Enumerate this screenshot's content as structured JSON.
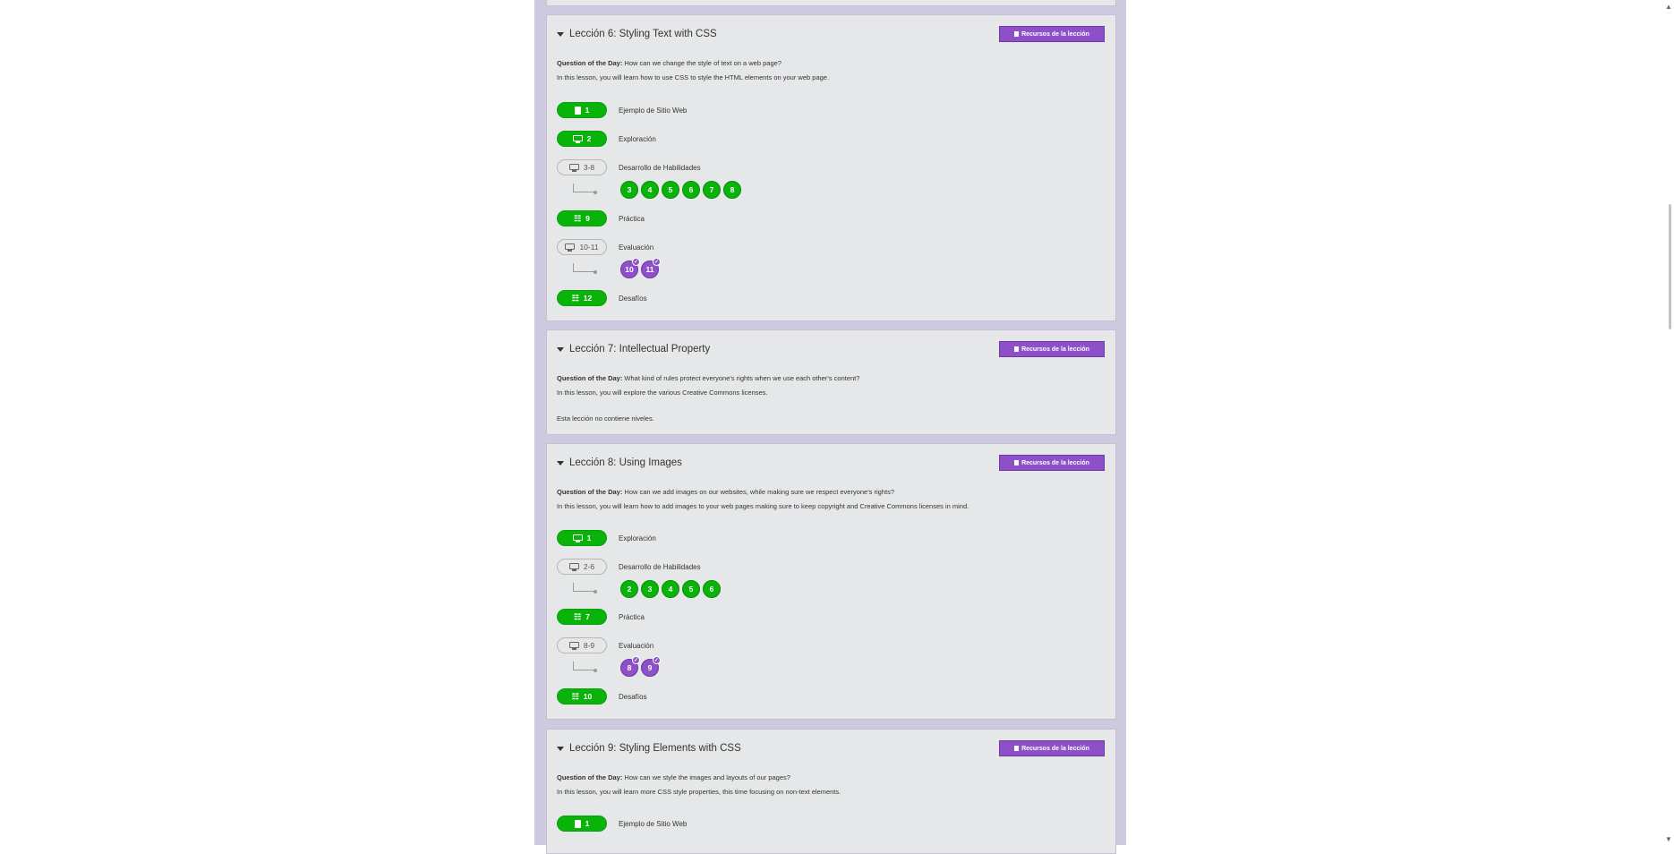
{
  "colors": {
    "green": "#0ab30a",
    "purple": "#8e50c8",
    "card_bg": "#e6e7e8",
    "column_bg": "#cfc9df"
  },
  "resources_label": "Recursos de la lección",
  "lesson6": {
    "title": "Lección 6: Styling Text with CSS",
    "qod_label": "Question of the Day:",
    "qod_text": " How can we change the style of text on a web page?",
    "description": "In this lesson, you will learn how to use CSS to style the HTML elements on your web page.",
    "levels": [
      {
        "badge": "1",
        "label": "Ejemplo de Sitio Web",
        "icon": "document-icon",
        "style": "green"
      },
      {
        "badge": "2",
        "label": "Exploración",
        "icon": "monitor-icon",
        "style": "green"
      },
      {
        "badge": "3-8",
        "label": "Desarrollo de Habilidades",
        "icon": "monitor-icon",
        "style": "outline"
      },
      {
        "badge": "9",
        "label": "Práctica",
        "icon": "hierarchy-icon",
        "style": "green"
      },
      {
        "badge": "10-11",
        "label": "Evaluación",
        "icon": "monitor-icon",
        "style": "outline"
      },
      {
        "badge": "12",
        "label": "Desafíos",
        "icon": "hierarchy-icon",
        "style": "green"
      }
    ],
    "skill_bubbles": [
      "3",
      "4",
      "5",
      "6",
      "7",
      "8"
    ],
    "assessment_bubbles": [
      "10",
      "11"
    ]
  },
  "lesson7": {
    "title": "Lección 7: Intellectual Property",
    "qod_label": "Question of the Day:",
    "qod_text": " What kind of rules protect everyone's rights when we use each other's content?",
    "description": "In this lesson, you will explore the various Creative Commons licenses.",
    "no_levels": "Esta lección no contiene niveles."
  },
  "lesson8": {
    "title": "Lección 8: Using Images",
    "qod_label": "Question of the Day:",
    "qod_text": " How can we add images on our websites, while making sure we respect everyone's rights?",
    "description": "In this lesson, you will learn how to add images to your web pages making sure to keep copyright and Creative Commons licenses in mind.",
    "levels": [
      {
        "badge": "1",
        "label": "Exploración",
        "icon": "monitor-icon",
        "style": "green"
      },
      {
        "badge": "2-6",
        "label": "Desarrollo de Habilidades",
        "icon": "monitor-icon",
        "style": "outline"
      },
      {
        "badge": "7",
        "label": "Práctica",
        "icon": "hierarchy-icon",
        "style": "green"
      },
      {
        "badge": "8-9",
        "label": "Evaluación",
        "icon": "monitor-icon",
        "style": "outline"
      },
      {
        "badge": "10",
        "label": "Desafíos",
        "icon": "hierarchy-icon",
        "style": "green"
      }
    ],
    "skill_bubbles": [
      "2",
      "3",
      "4",
      "5",
      "6"
    ],
    "assessment_bubbles": [
      "8",
      "9"
    ]
  },
  "lesson9": {
    "title": "Lección 9: Styling Elements with CSS",
    "qod_label": "Question of the Day:",
    "qod_text": " How can we style the images and layouts of our pages?",
    "description": "In this lesson, you will learn more CSS style properties, this time focusing on non-text elements.",
    "levels": [
      {
        "badge": "1",
        "label": "Ejemplo de Sitio Web",
        "icon": "document-icon",
        "style": "green"
      }
    ]
  }
}
